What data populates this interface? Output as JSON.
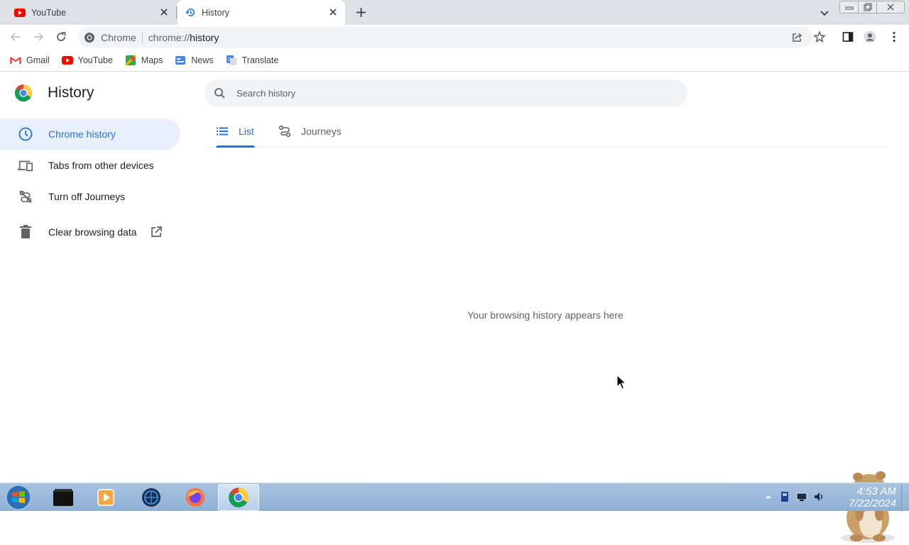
{
  "browser": {
    "tabs": [
      {
        "title": "YouTube",
        "icon": "youtube-icon",
        "active": false
      },
      {
        "title": "History",
        "icon": "history-icon",
        "active": true
      }
    ],
    "omnibox": {
      "chip": "Chrome",
      "url_scheme": "chrome://",
      "url_path": "history"
    },
    "bookmarks": [
      {
        "label": "Gmail",
        "icon": "gmail-icon"
      },
      {
        "label": "YouTube",
        "icon": "youtube-icon"
      },
      {
        "label": "Maps",
        "icon": "maps-icon"
      },
      {
        "label": "News",
        "icon": "news-icon"
      },
      {
        "label": "Translate",
        "icon": "translate-icon"
      }
    ]
  },
  "history": {
    "title": "History",
    "search_placeholder": "Search history",
    "nav": [
      {
        "label": "Chrome history",
        "icon": "clock-icon",
        "active": true
      },
      {
        "label": "Tabs from other devices",
        "icon": "devices-icon",
        "active": false
      },
      {
        "label": "Turn off Journeys",
        "icon": "journeys-off-icon",
        "active": false
      },
      {
        "label": "Clear browsing data",
        "icon": "trash-icon",
        "active": false
      }
    ],
    "tabs": [
      {
        "label": "List",
        "icon": "list-icon",
        "selected": true
      },
      {
        "label": "Journeys",
        "icon": "journeys-icon",
        "selected": false
      }
    ],
    "empty_message": "Your browsing history appears here"
  },
  "taskbar": {
    "clock_time": "4:53 AM",
    "clock_date": "7/22/2024"
  },
  "colors": {
    "accent": "#1a73e8",
    "active_nav_bg": "#e8f0fe",
    "tabstrip_bg": "#dee1e6",
    "omnibox_bg": "#f1f3f4"
  }
}
